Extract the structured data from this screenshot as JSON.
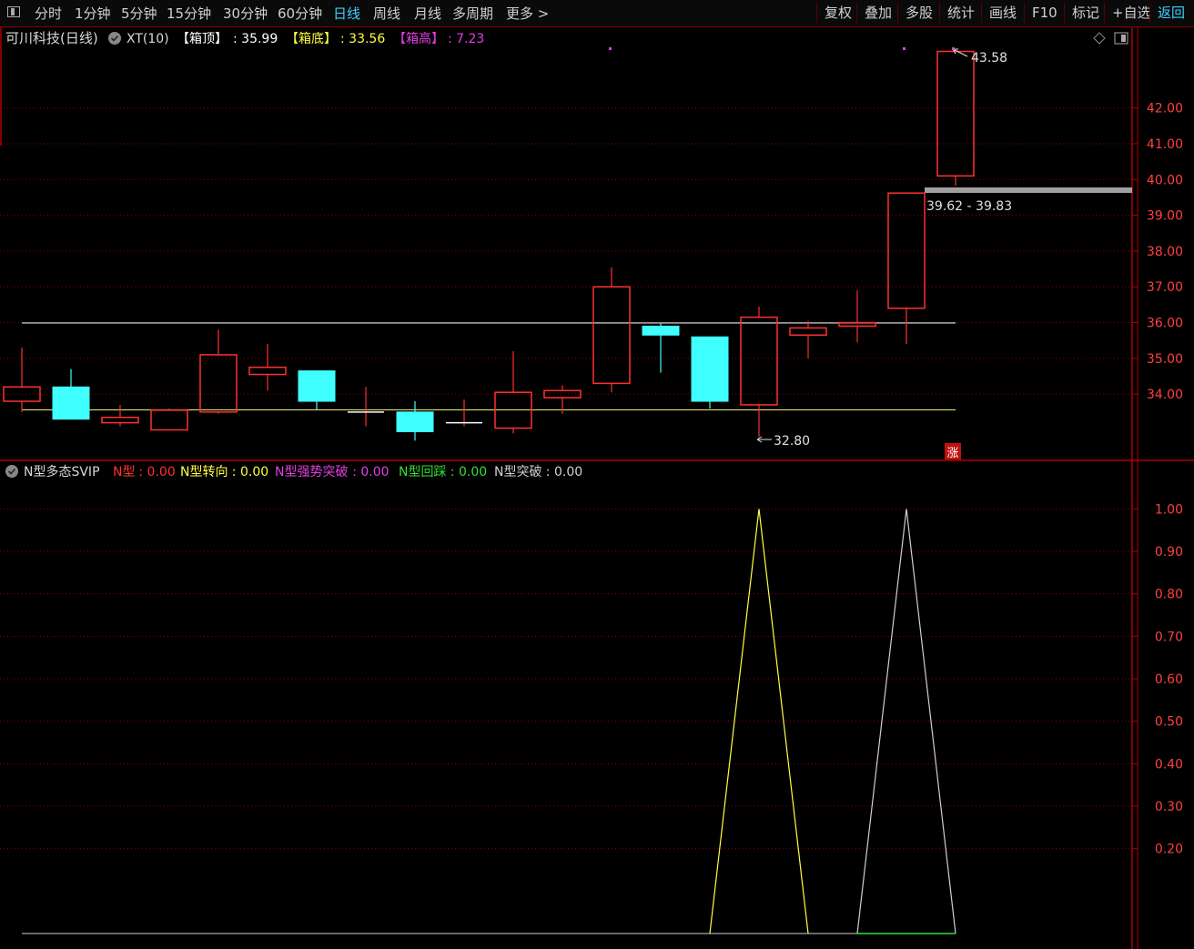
{
  "toolbar": {
    "periods": [
      "分时",
      "1分钟",
      "5分钟",
      "15分钟",
      "30分钟",
      "60分钟",
      "日线",
      "周线",
      "月线",
      "多周期",
      "更多 >"
    ],
    "active": "日线",
    "right_buttons": [
      "复权",
      "叠加",
      "多股",
      "统计",
      "画线",
      "F10",
      "标记",
      "+自选",
      "返回"
    ]
  },
  "main_panel": {
    "stock_name": "可川科技(日线)",
    "indicator": "XT(10)",
    "box_top_label": "【箱顶】",
    "box_top_value": ": 35.99",
    "box_bottom_label": "【箱底】",
    "box_bottom_value": ": 33.56",
    "box_height_label": "【箱高】",
    "box_height_value": ": 7.23",
    "high_label": "43.58",
    "low_label": "32.80",
    "range_label": "39.62 - 39.83",
    "rise_badge": "涨"
  },
  "sub_panel": {
    "name": "N型多态SVIP",
    "items": [
      {
        "label": "N型",
        "value": ": 0.00",
        "color": "#ff3030"
      },
      {
        "label": "N型转向",
        "value": ": 0.00",
        "color": "#ffff40"
      },
      {
        "label": "N型强势突破",
        "value": ": 0.00",
        "color": "#e040e0"
      },
      {
        "label": "N型回踩",
        "value": ": 0.00",
        "color": "#30e030"
      },
      {
        "label": "N型突破",
        "value": ": 0.00",
        "color": "#d0d0d0"
      }
    ]
  },
  "colors": {
    "up": "#ff3030",
    "down": "#40ffff",
    "grid": "#8b0000",
    "box_top_line": "#e8e8e8",
    "box_bottom_line": "#e8e070",
    "accent": "#3fd0ff"
  },
  "chart_data": [
    {
      "type": "candlestick",
      "ylim": [
        32.3,
        44.0
      ],
      "yticks": [
        34.0,
        35.0,
        36.0,
        37.0,
        38.0,
        39.0,
        40.0,
        41.0,
        42.0
      ],
      "box_top": 35.99,
      "box_bottom": 33.56,
      "candles": [
        {
          "o": 33.8,
          "h": 35.3,
          "l": 33.5,
          "c": 34.2
        },
        {
          "o": 34.2,
          "h": 34.7,
          "l": 33.3,
          "c": 33.3
        },
        {
          "o": 33.2,
          "h": 33.7,
          "l": 33.1,
          "c": 33.35
        },
        {
          "o": 33.0,
          "h": 33.6,
          "l": 33.0,
          "c": 33.55
        },
        {
          "o": 33.5,
          "h": 35.8,
          "l": 33.45,
          "c": 35.1
        },
        {
          "o": 34.55,
          "h": 35.4,
          "l": 34.1,
          "c": 34.75
        },
        {
          "o": 34.65,
          "h": 34.65,
          "l": 33.55,
          "c": 33.8
        },
        {
          "o": 33.5,
          "h": 34.2,
          "l": 33.1,
          "c": 33.5
        },
        {
          "o": 33.5,
          "h": 33.8,
          "l": 32.7,
          "c": 32.95
        },
        {
          "o": 33.2,
          "h": 33.85,
          "l": 33.1,
          "c": 33.2
        },
        {
          "o": 33.05,
          "h": 35.2,
          "l": 32.9,
          "c": 34.05
        },
        {
          "o": 33.9,
          "h": 34.25,
          "l": 33.45,
          "c": 34.1
        },
        {
          "o": 34.3,
          "h": 37.55,
          "l": 34.05,
          "c": 37.0
        },
        {
          "o": 35.9,
          "h": 36.0,
          "l": 34.6,
          "c": 35.65
        },
        {
          "o": 35.6,
          "h": 35.6,
          "l": 33.6,
          "c": 33.8
        },
        {
          "o": 33.7,
          "h": 36.45,
          "l": 32.8,
          "c": 36.15
        },
        {
          "o": 35.65,
          "h": 36.05,
          "l": 35.0,
          "c": 35.85
        },
        {
          "o": 35.9,
          "h": 36.9,
          "l": 35.45,
          "c": 36.0
        },
        {
          "o": 36.4,
          "h": 39.62,
          "l": 35.4,
          "c": 39.62
        },
        {
          "o": 40.1,
          "h": 43.58,
          "l": 39.83,
          "c": 43.58
        }
      ]
    },
    {
      "type": "line",
      "ylim": [
        0,
        1.05
      ],
      "yticks": [
        0.2,
        0.3,
        0.4,
        0.5,
        0.6,
        0.7,
        0.8,
        0.9,
        1.0
      ],
      "series": [
        {
          "name": "N型转向",
          "color": "#ffff40",
          "values": [
            0,
            0,
            0,
            0,
            0,
            0,
            0,
            0,
            0,
            0,
            0,
            0,
            0,
            0,
            0,
            1,
            0,
            0,
            0,
            0
          ]
        },
        {
          "name": "N型突破",
          "color": "#d0d0d0",
          "values": [
            0,
            0,
            0,
            0,
            0,
            0,
            0,
            0,
            0,
            0,
            0,
            0,
            0,
            0,
            0,
            0,
            0,
            0,
            1,
            0
          ]
        },
        {
          "name": "N型回踩",
          "color": "#30e030",
          "values": [
            0,
            0,
            0,
            0,
            0,
            0,
            0,
            0,
            0,
            0,
            0,
            0,
            0,
            0,
            0,
            0,
            0,
            0,
            0,
            0
          ]
        }
      ]
    }
  ]
}
